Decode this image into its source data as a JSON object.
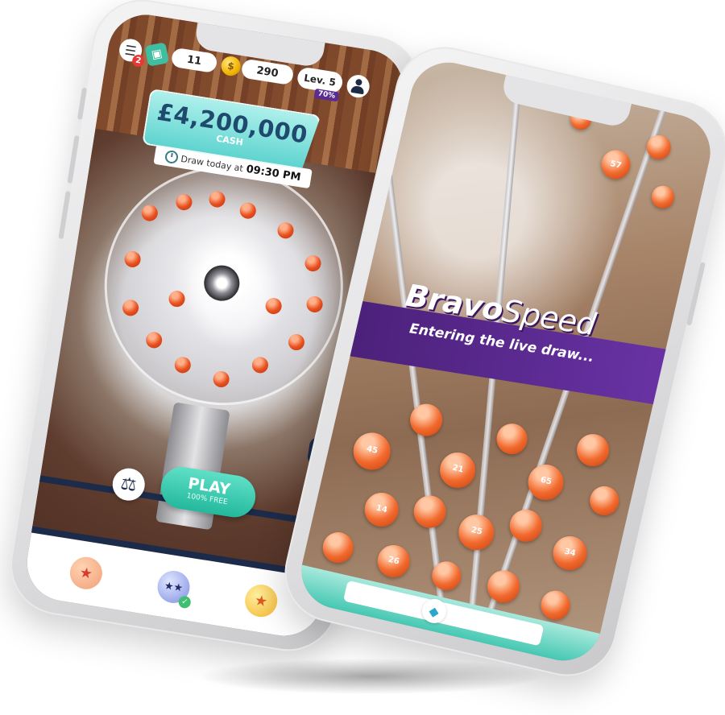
{
  "phone1": {
    "topbar": {
      "menu_badge": "2",
      "tickets_count": "11",
      "coins_count": "290",
      "level_label": "Lev. 5",
      "level_progress": "70%"
    },
    "jackpot": {
      "amount": "£4,200,000",
      "label": "CASH",
      "draw_prefix": "Draw today at",
      "draw_time": "09:30 PM"
    },
    "play": {
      "label": "PLAY",
      "sub": "100% FREE"
    }
  },
  "phone2": {
    "brand_bravo": "Bravo",
    "brand_speed": "Speed",
    "subtitle": "Entering the live draw...",
    "ball_numbers": [
      "57",
      "45",
      "21",
      "65",
      "14",
      "25",
      "34",
      "26"
    ]
  },
  "colors": {
    "accent_teal": "#23b89c",
    "brand_purple": "#5b2c91",
    "navy": "#1c2b4a",
    "ball_orange": "#f2692d"
  },
  "icons": [
    "menu-icon",
    "ticket-icon",
    "coin-icon",
    "user-icon",
    "clock-icon",
    "scales-icon",
    "grid-icon",
    "dialpad-icon",
    "star-icon",
    "stars-icon",
    "diamond-icon"
  ]
}
